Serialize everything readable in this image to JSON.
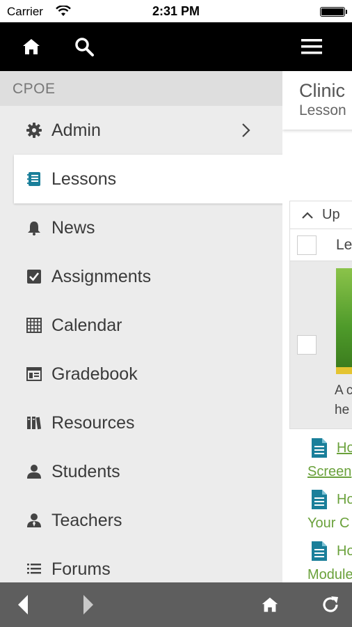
{
  "status_bar": {
    "carrier": "Carrier",
    "time": "2:31 PM",
    "battery_level": 1.0
  },
  "top_bar": {
    "home_icon": "home-icon",
    "search_icon": "search-icon",
    "menu_icon": "hamburger-menu-icon"
  },
  "sidebar": {
    "title": "CPOE",
    "items": [
      {
        "label": "Admin",
        "icon": "gear-icon",
        "has_submenu": true
      },
      {
        "label": "Lessons",
        "icon": "lessons-book-icon",
        "active": true
      },
      {
        "label": "News",
        "icon": "bell-icon"
      },
      {
        "label": "Assignments",
        "icon": "checkbox-icon"
      },
      {
        "label": "Calendar",
        "icon": "calendar-grid-icon"
      },
      {
        "label": "Gradebook",
        "icon": "gradebook-icon"
      },
      {
        "label": "Resources",
        "icon": "books-icon"
      },
      {
        "label": "Students",
        "icon": "person-icon"
      },
      {
        "label": "Teachers",
        "icon": "teacher-icon"
      },
      {
        "label": "Forums",
        "icon": "list-icon"
      }
    ]
  },
  "content": {
    "title": "Clinic",
    "subtitle": "Lesson",
    "up_label": "Up",
    "column_header": "Le",
    "row_desc_line1": "A c",
    "row_desc_line2": "he",
    "links": [
      {
        "line1": "Ho",
        "line2": "Screen"
      },
      {
        "line1": "Ho",
        "line2": "Your C"
      },
      {
        "line1": "Ho",
        "line2": "Module"
      }
    ]
  },
  "bottom_bar": {
    "back_icon": "back-arrow-icon",
    "forward_icon": "forward-arrow-icon",
    "home_icon": "home-icon",
    "reload_icon": "reload-icon"
  },
  "colors": {
    "top_bar": "#000000",
    "bottom_bar": "#5e5e5e",
    "sidebar_bg": "#ececec",
    "link_green": "#6aa13b",
    "doc_icon_teal": "#1a7f9a"
  }
}
